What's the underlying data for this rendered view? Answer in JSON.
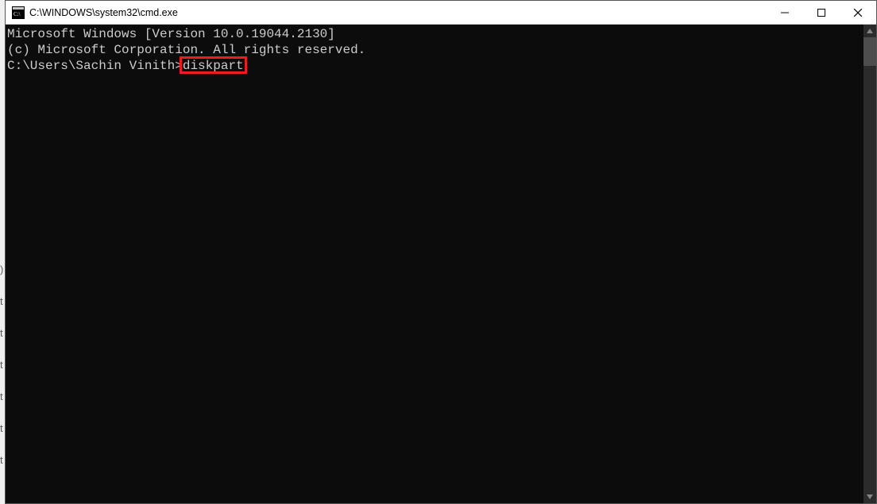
{
  "window": {
    "title": "C:\\WINDOWS\\system32\\cmd.exe"
  },
  "terminal": {
    "line1": "Microsoft Windows [Version 10.0.19044.2130]",
    "line2": "(c) Microsoft Corporation. All rights reserved.",
    "blank": "",
    "prompt": "C:\\Users\\Sachin Vinith>",
    "command": "diskpart"
  },
  "highlight": {
    "target": "diskpart"
  },
  "icons": {
    "app": "cmd-icon",
    "minimize": "minimize-icon",
    "maximize": "maximize-icon",
    "close": "close-icon",
    "scrollUp": "scroll-up-icon",
    "scrollDown": "scroll-down-icon"
  }
}
